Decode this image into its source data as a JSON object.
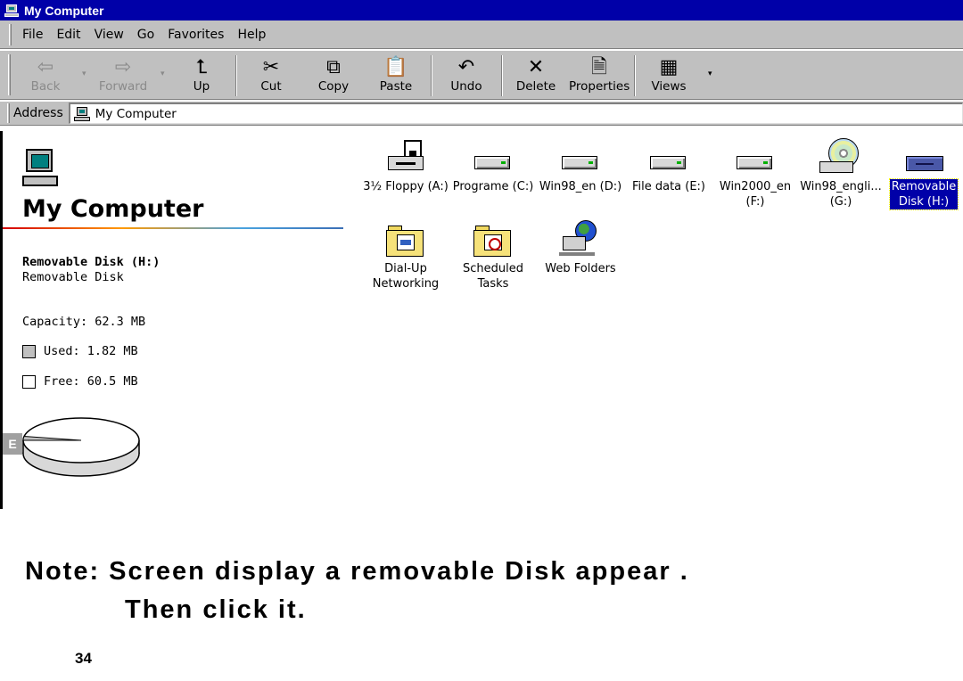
{
  "window": {
    "title": "My Computer"
  },
  "menu": [
    "File",
    "Edit",
    "View",
    "Go",
    "Favorites",
    "Help"
  ],
  "toolbar": {
    "back": "Back",
    "forward": "Forward",
    "up": "Up",
    "cut": "Cut",
    "copy": "Copy",
    "paste": "Paste",
    "undo": "Undo",
    "delete": "Delete",
    "properties": "Properties",
    "views": "Views"
  },
  "address": {
    "label": "Address",
    "value": "My Computer"
  },
  "info_pane": {
    "heading": "My Computer",
    "selected_name": "Removable Disk (H:)",
    "selected_type": "Removable Disk",
    "capacity": "Capacity: 62.3 MB",
    "used": "Used: 1.82 MB",
    "free": "Free: 60.5 MB",
    "drive_letter": "E",
    "used_fraction": 0.029,
    "colors": {
      "used": "#c0c0c0",
      "free": "#ffffff"
    }
  },
  "icons": [
    {
      "name": "floppy-drive",
      "caption": "3½ Floppy (A:)",
      "type": "floppy",
      "selected": false
    },
    {
      "name": "drive-c",
      "caption": "Programe (C:)",
      "type": "drive",
      "selected": false
    },
    {
      "name": "drive-d",
      "caption": "Win98_en (D:)",
      "type": "drive",
      "selected": false
    },
    {
      "name": "drive-e",
      "caption": "File data (E:)",
      "type": "drive",
      "selected": false
    },
    {
      "name": "drive-f",
      "caption": "Win2000_en\n(F:)",
      "type": "drive",
      "selected": false
    },
    {
      "name": "cd-drive-g",
      "caption": "Win98_engli...\n(G:)",
      "type": "cd",
      "selected": false
    },
    {
      "name": "removable-disk-h",
      "caption": "Removable\nDisk (H:)",
      "type": "removable",
      "selected": true
    },
    {
      "name": "dial-up-networking",
      "caption": "Dial-Up\nNetworking",
      "type": "folder-phone",
      "selected": false
    },
    {
      "name": "scheduled-tasks",
      "caption": "Scheduled\nTasks",
      "type": "folder-clock",
      "selected": false
    },
    {
      "name": "web-folders",
      "caption": "Web Folders",
      "type": "webfolder",
      "selected": false
    }
  ],
  "note": {
    "line1": "Note: Screen display a removable Disk appear .",
    "line2": "Then click it."
  },
  "page_number": "34"
}
